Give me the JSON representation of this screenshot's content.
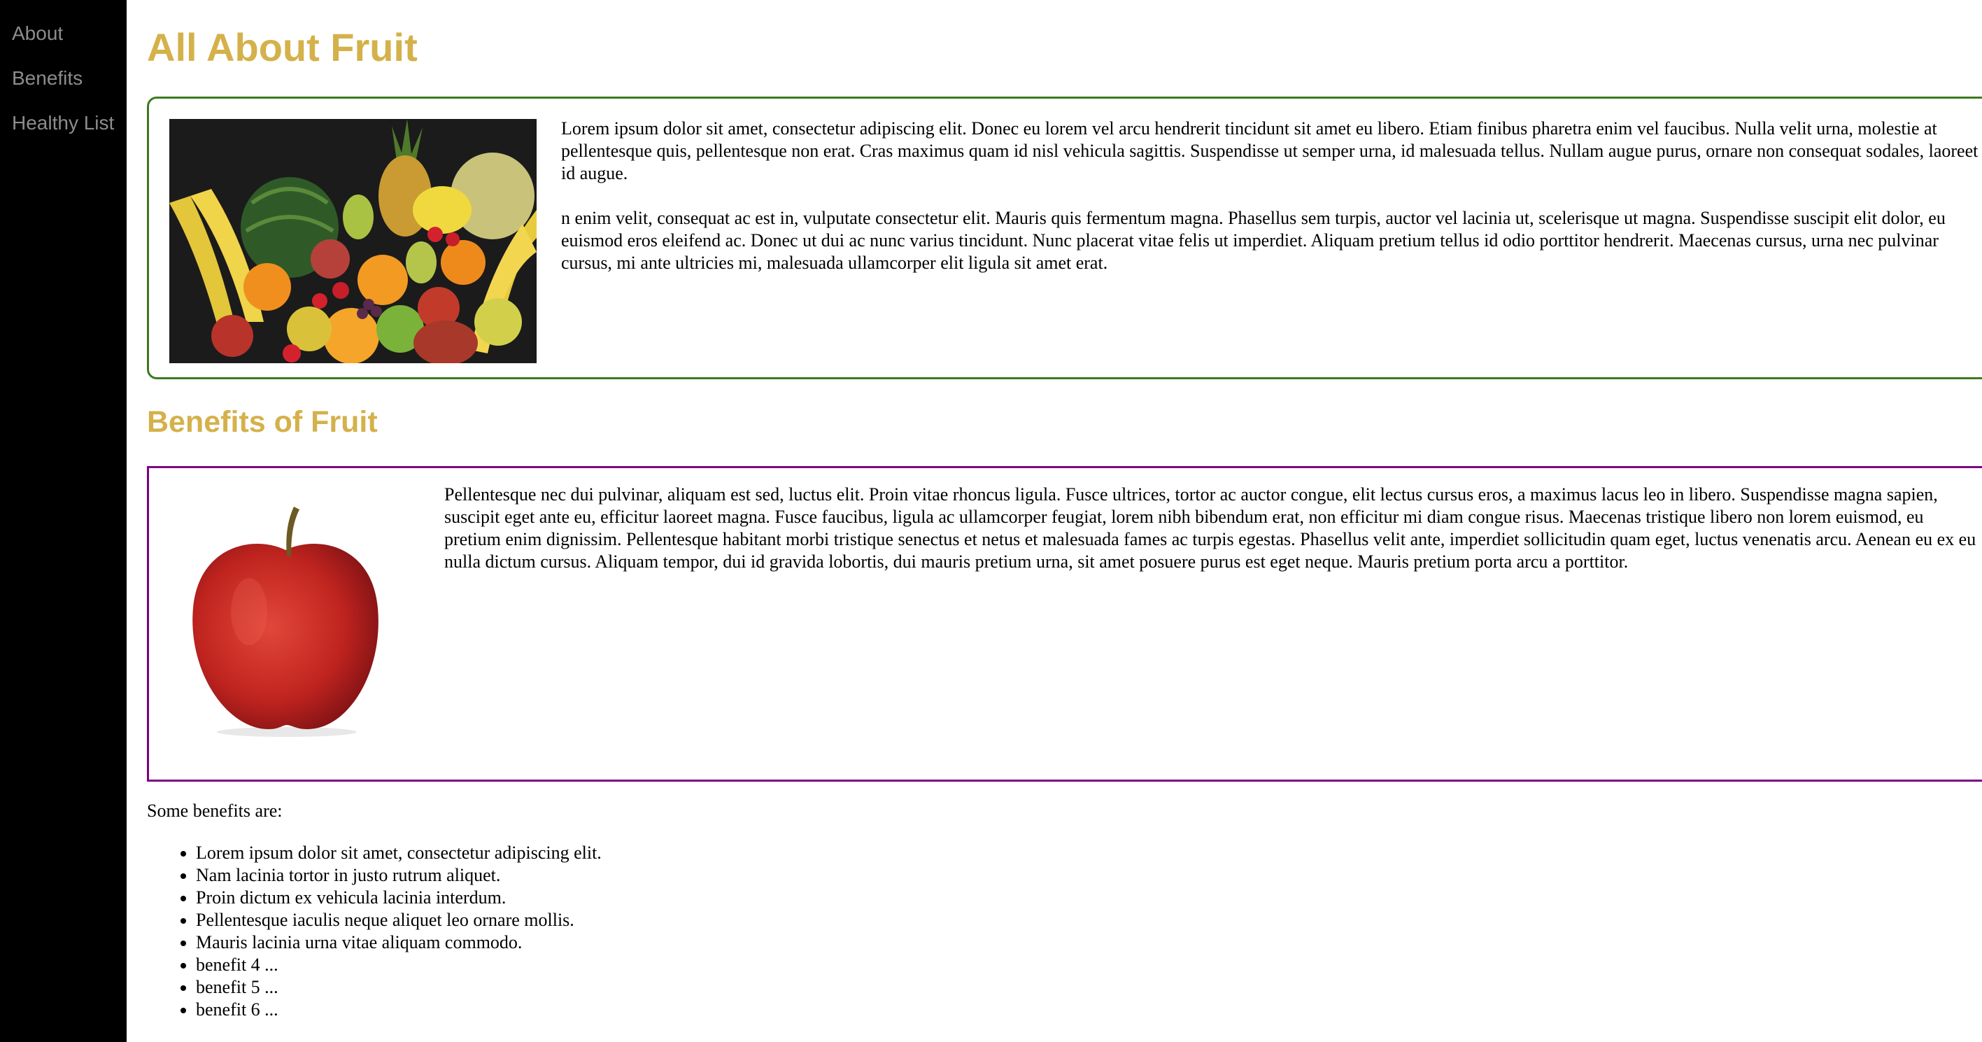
{
  "sidebar": {
    "items": [
      {
        "label": "About"
      },
      {
        "label": "Benefits"
      },
      {
        "label": "Healthy List"
      }
    ]
  },
  "main": {
    "title": "All About Fruit",
    "about": {
      "paragraphs": [
        "Lorem ipsum dolor sit amet, consectetur adipiscing elit. Donec eu lorem vel arcu hendrerit tincidunt sit amet eu libero. Etiam finibus pharetra enim vel faucibus. Nulla velit urna, molestie at pellentesque quis, pellentesque non erat. Cras maximus quam id nisl vehicula sagittis. Suspendisse ut semper urna, id malesuada tellus. Nullam augue purus, ornare non consequat sodales, laoreet id augue.",
        "n enim velit, consequat ac est in, vulputate consectetur elit. Mauris quis fermentum magna. Phasellus sem turpis, auctor vel lacinia ut, scelerisque ut magna. Suspendisse suscipit elit dolor, eu euismod eros eleifend ac. Donec ut dui ac nunc varius tincidunt. Nunc placerat vitae felis ut imperdiet. Aliquam pretium tellus id odio porttitor hendrerit. Maecenas cursus, urna nec pulvinar cursus, mi ante ultricies mi, malesuada ullamcorper elit ligula sit amet erat."
      ]
    },
    "benefits": {
      "title": "Benefits of Fruit",
      "paragraph": "Pellentesque nec dui pulvinar, aliquam est sed, luctus elit. Proin vitae rhoncus ligula. Fusce ultrices, tortor ac auctor congue, elit lectus cursus eros, a maximus lacus leo in libero. Suspendisse magna sapien, suscipit eget ante eu, efficitur laoreet magna. Fusce faucibus, ligula ac ullamcorper feugiat, lorem nibh bibendum erat, non efficitur mi diam congue risus. Maecenas tristique libero non lorem euismod, eu pretium enim dignissim. Pellentesque habitant morbi tristique senectus et netus et malesuada fames ac turpis egestas. Phasellus velit ante, imperdiet sollicitudin quam eget, luctus venenatis arcu. Aenean eu ex eu nulla dictum cursus. Aliquam tempor, dui id gravida lobortis, dui mauris pretium urna, sit amet posuere purus est eget neque. Mauris pretium porta arcu a porttitor.",
      "intro": "Some benefits are:",
      "list": [
        "Lorem ipsum dolor sit amet, consectetur adipiscing elit.",
        "Nam lacinia tortor in justo rutrum aliquet.",
        "Proin dictum ex vehicula lacinia interdum.",
        "Pellentesque iaculis neque aliquet leo ornare mollis.",
        "Mauris lacinia urna vitae aliquam commodo.",
        "benefit 4 ...",
        "benefit 5 ...",
        "benefit 6 ..."
      ]
    }
  },
  "colors": {
    "heading": "#d4b14a",
    "sidebar_bg": "#000000",
    "sidebar_link": "#8c8c8c",
    "about_border": "#3d7a1f",
    "benefits_border": "#800080"
  },
  "images": {
    "about": "fruit-assortment-photo",
    "benefits": "red-apple-photo"
  }
}
